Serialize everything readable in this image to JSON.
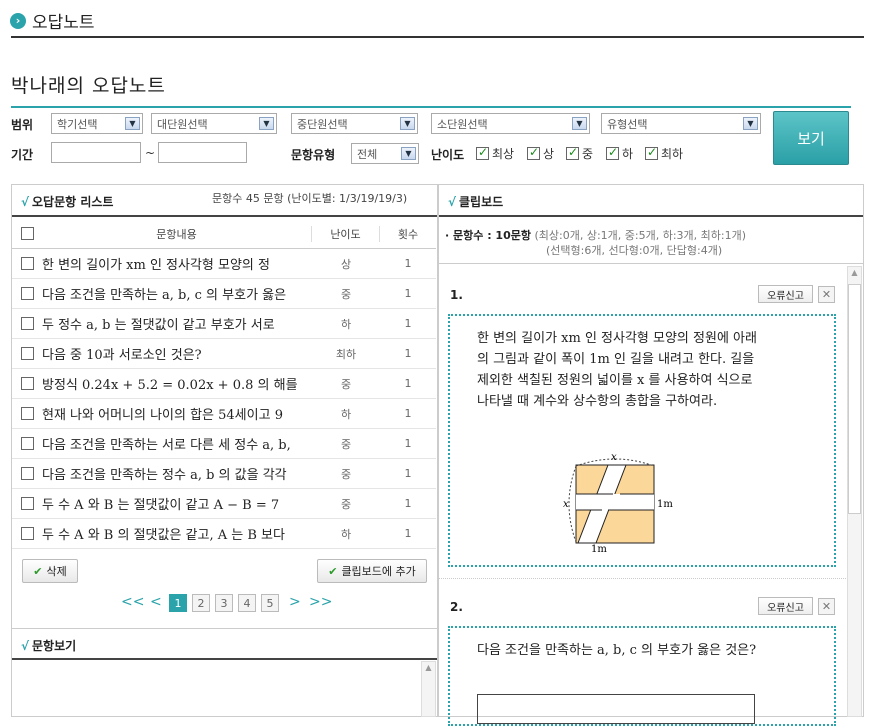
{
  "header": {
    "icon": "chevron-right-icon",
    "title": "오답노트"
  },
  "page_title": "박나래의 오답노트",
  "filters": {
    "scope_label": "범위",
    "selects": [
      "학기선택",
      "대단원선택",
      "중단원선택",
      "소단원선택",
      "유형선택"
    ],
    "period_label": "기간",
    "period_sep": "~",
    "type_label": "문항유형",
    "type_value": "전체",
    "difficulty_label": "난이도",
    "difficulty_options": [
      "최상",
      "상",
      "중",
      "하",
      "최하"
    ],
    "view_button": "보기"
  },
  "list": {
    "title": "오답문항 리스트",
    "summary": "문항수 45 문항 (난이도별: 1/3/19/19/3)",
    "columns": [
      "문항내용",
      "난이도",
      "횟수"
    ],
    "rows": [
      {
        "text": "한 변의 길이가 xm 인 정사각형 모양의 정",
        "difficulty": "상",
        "count": "1"
      },
      {
        "text": "다음 조건을 만족하는 a, b, c 의 부호가 옳은",
        "difficulty": "중",
        "count": "1"
      },
      {
        "text": "두 정수 a, b 는 절댓값이 같고 부호가 서로",
        "difficulty": "하",
        "count": "1"
      },
      {
        "text": "다음 중 10과 서로소인 것은?",
        "difficulty": "최하",
        "count": "1"
      },
      {
        "text": "방정식 0.24x + 5.2 = 0.02x + 0.8 의 해를",
        "difficulty": "중",
        "count": "1"
      },
      {
        "text": "현재 나와 어머니의 나이의 합은 54세이고 9",
        "difficulty": "하",
        "count": "1"
      },
      {
        "text": "다음 조건을 만족하는 서로 다른 세 정수 a, b,",
        "difficulty": "중",
        "count": "1"
      },
      {
        "text": "다음 조건을 만족하는 정수 a, b 의 값을 각각",
        "difficulty": "중",
        "count": "1"
      },
      {
        "text": "두 수 A 와 B 는 절댓값이 같고 A − B = 7",
        "difficulty": "중",
        "count": "1"
      },
      {
        "text": "두 수 A 와 B 의 절댓값은 같고, A 는 B 보다",
        "difficulty": "하",
        "count": "1"
      }
    ],
    "delete_button": "삭제",
    "add_button": "클립보드에 추가",
    "pager": {
      "first": "<<",
      "prev": "<",
      "pages": [
        "1",
        "2",
        "3",
        "4",
        "5"
      ],
      "current": "1",
      "next": ">",
      "last": ">>"
    }
  },
  "preview": {
    "title": "문항보기"
  },
  "clipboard": {
    "title": "클립보드",
    "count_label": "· 문항수 : 10문항",
    "count_detail": "(최상:0개, 상:1개, 중:5개, 하:3개, 최하:1개)",
    "count_detail2": "(선택형:6개, 선다형:0개, 단답형:4개)",
    "report_button": "오류신고",
    "questions": [
      {
        "num": "1.",
        "text": "한 변의 길이가 xm 인 정사각형 모양의 정원에 아래의 그림과 같이 폭이 1m 인 길을 내려고 한다. 길을 제외한 색칠된 정원의 넓이를 x 를 사용하여 식으로 나타낼 때 계수와 상수항의 총합을 구하여라.",
        "fig_x_top": "x",
        "fig_x_left": "x",
        "fig_1m_right": "1m",
        "fig_1m_bottom": "1m"
      },
      {
        "num": "2.",
        "text": "다음 조건을 만족하는 a, b, c 의 부호가 옳은 것은?"
      }
    ]
  },
  "colors": {
    "accent": "#2aa3ab",
    "figure_fill": "#fcd79a",
    "check": "#1a8a1a"
  }
}
